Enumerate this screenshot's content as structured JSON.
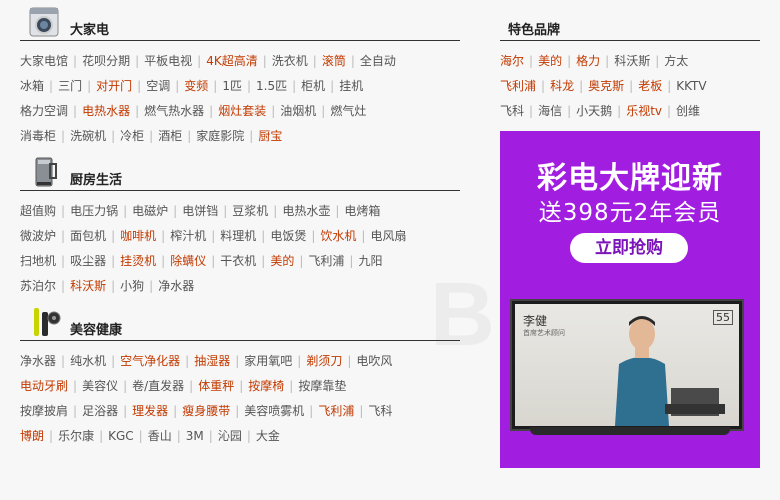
{
  "sections": [
    {
      "title": "大家电",
      "icon": "washing-machine-icon",
      "rows": [
        [
          {
            "t": "大家电馆"
          },
          {
            "t": "花呗分期"
          },
          {
            "t": "平板电视"
          },
          {
            "t": "4K超高清",
            "hl": true
          },
          {
            "t": "洗衣机"
          },
          {
            "t": "滚筒",
            "hl": true
          },
          {
            "t": "全自动"
          }
        ],
        [
          {
            "t": "冰箱"
          },
          {
            "t": "三门"
          },
          {
            "t": "对开门",
            "hl": true
          },
          {
            "t": "空调"
          },
          {
            "t": "变频",
            "hl": true
          },
          {
            "t": "1匹"
          },
          {
            "t": "1.5匹"
          },
          {
            "t": "柜机"
          },
          {
            "t": "挂机"
          }
        ],
        [
          {
            "t": "格力空调"
          },
          {
            "t": "电热水器",
            "hl": true
          },
          {
            "t": "燃气热水器"
          },
          {
            "t": "烟灶套装",
            "hl": true
          },
          {
            "t": "油烟机"
          },
          {
            "t": "燃气灶"
          }
        ],
        [
          {
            "t": "消毒柜"
          },
          {
            "t": "洗碗机"
          },
          {
            "t": "冷柜"
          },
          {
            "t": "酒柜"
          },
          {
            "t": "家庭影院"
          },
          {
            "t": "厨宝",
            "hl": true
          }
        ]
      ]
    },
    {
      "title": "厨房生活",
      "icon": "kettle-icon",
      "rows": [
        [
          {
            "t": "超值购"
          },
          {
            "t": "电压力锅"
          },
          {
            "t": "电磁炉"
          },
          {
            "t": "电饼铛"
          },
          {
            "t": "豆浆机"
          },
          {
            "t": "电热水壶"
          },
          {
            "t": "电烤箱"
          }
        ],
        [
          {
            "t": "微波炉"
          },
          {
            "t": "面包机"
          },
          {
            "t": "咖啡机",
            "hl": true
          },
          {
            "t": "榨汁机"
          },
          {
            "t": "料理机"
          },
          {
            "t": "电饭煲"
          },
          {
            "t": "饮水机",
            "hl": true
          },
          {
            "t": "电风扇"
          }
        ],
        [
          {
            "t": "扫地机"
          },
          {
            "t": "吸尘器"
          },
          {
            "t": "挂烫机",
            "hl": true
          },
          {
            "t": "除螨仪",
            "hl": true
          },
          {
            "t": "干衣机"
          },
          {
            "t": "美的",
            "hl": true
          },
          {
            "t": "飞利浦"
          },
          {
            "t": "九阳"
          }
        ],
        [
          {
            "t": "苏泊尔"
          },
          {
            "t": "科沃斯",
            "hl": true
          },
          {
            "t": "小狗"
          },
          {
            "t": "净水器"
          }
        ]
      ]
    },
    {
      "title": "美容健康",
      "icon": "shaver-icon",
      "rows": [
        [
          {
            "t": "净水器"
          },
          {
            "t": "纯水机"
          },
          {
            "t": "空气净化器",
            "hl": true
          },
          {
            "t": "抽湿器",
            "hl": true
          },
          {
            "t": "家用氧吧"
          },
          {
            "t": "剃须刀",
            "hl": true
          },
          {
            "t": "电吹风"
          }
        ],
        [
          {
            "t": "电动牙刷",
            "hl": true
          },
          {
            "t": "美容仪"
          },
          {
            "t": "卷/直发器"
          },
          {
            "t": "体重秤",
            "hl": true
          },
          {
            "t": "按摩椅",
            "hl": true
          },
          {
            "t": "按摩靠垫"
          }
        ],
        [
          {
            "t": "按摩披肩"
          },
          {
            "t": "足浴器"
          },
          {
            "t": "理发器",
            "hl": true
          },
          {
            "t": "瘦身腰带",
            "hl": true
          },
          {
            "t": "美容喷雾机"
          },
          {
            "t": "飞利浦",
            "hl": true
          },
          {
            "t": "飞科"
          }
        ],
        [
          {
            "t": "博朗",
            "hl": true
          },
          {
            "t": "乐尔康"
          },
          {
            "t": "KGC"
          },
          {
            "t": "香山"
          },
          {
            "t": "3M"
          },
          {
            "t": "沁园"
          },
          {
            "t": "大金"
          }
        ]
      ]
    }
  ],
  "brands": {
    "title": "特色品牌",
    "rows": [
      [
        {
          "t": "海尔",
          "hl": true
        },
        {
          "t": "美的",
          "hl": true
        },
        {
          "t": "格力",
          "hl": true
        },
        {
          "t": "科沃斯"
        },
        {
          "t": "方太"
        }
      ],
      [
        {
          "t": "飞利浦",
          "hl": true
        },
        {
          "t": "科龙",
          "hl": true
        },
        {
          "t": "奥克斯",
          "hl": true
        },
        {
          "t": "老板",
          "hl": true
        },
        {
          "t": "KKTV"
        }
      ],
      [
        {
          "t": "飞科"
        },
        {
          "t": "海信"
        },
        {
          "t": "小天鹅"
        },
        {
          "t": "乐视tv",
          "hl": true
        },
        {
          "t": "创维"
        }
      ]
    ]
  },
  "banner": {
    "headline": "彩电大牌迎新",
    "subline": "送398元2年会员",
    "cta": "立即抢购",
    "tv_name": "李健",
    "tv_sub": "首席艺术顾问",
    "tv_size": "55"
  },
  "colors": {
    "highlight": "#c23a00",
    "banner_bg": "#a11ee0"
  }
}
